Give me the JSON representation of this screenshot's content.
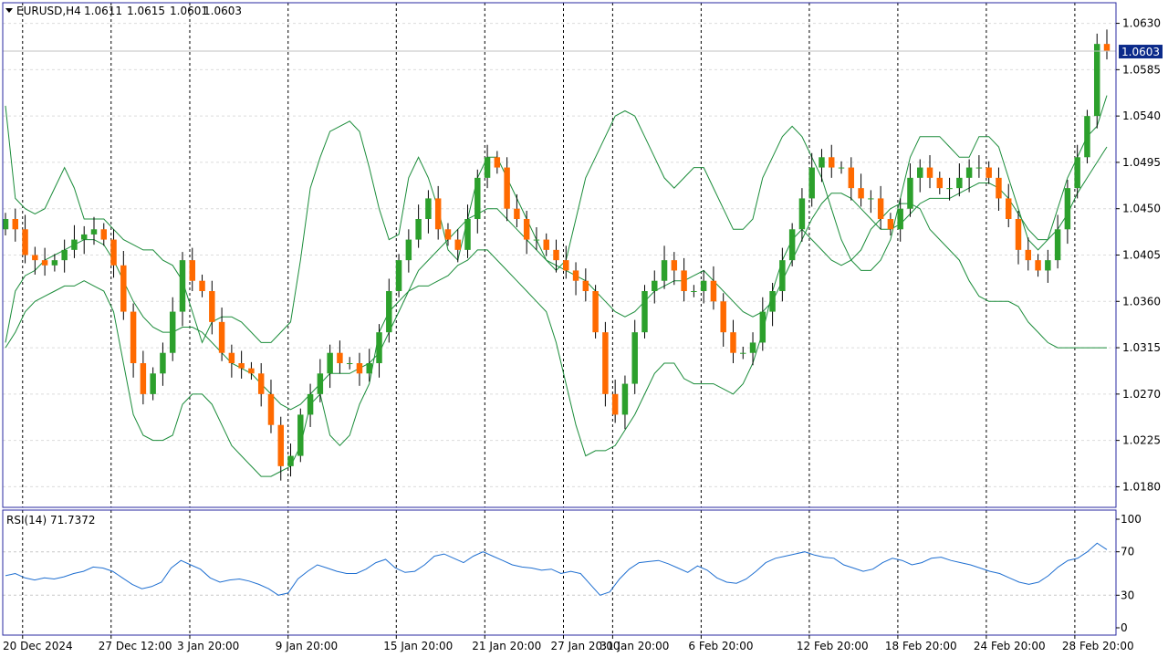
{
  "header": {
    "symbol": "EURUSD,H4",
    "open": "1.0611",
    "high": "1.0615",
    "low": "1.0601",
    "close": "1.0603"
  },
  "price_panel": {
    "current_price_label": "1.0603",
    "y_ticks": [
      "1.0630",
      "1.0585",
      "1.0540",
      "1.0495",
      "1.0450",
      "1.0405",
      "1.0360",
      "1.0315",
      "1.0270",
      "1.0225",
      "1.0180"
    ]
  },
  "rsi_panel": {
    "title": "RSI(14) 71.7372",
    "y_ticks": [
      "100",
      "70",
      "30",
      "0"
    ]
  },
  "x_axis_labels": [
    "20 Dec 2024",
    "27 Dec 12:00",
    "3 Jan 20:00",
    "9 Jan 20:00",
    "15 Jan 20:00",
    "21 Jan 20:00",
    "27 Jan 20:00",
    "31 Jan 20:00",
    "6 Feb 20:00",
    "12 Feb 20:00",
    "18 Feb 20:00",
    "24 Feb 20:00",
    "28 Feb 20:00"
  ],
  "colors": {
    "bull_candle": "#2ca02c",
    "bear_candle": "#ff6a00",
    "bollinger": "#1b8c3a",
    "rsi_line": "#1f6fd1",
    "frame": "#2a2aa0",
    "price_label_bg": "#0b2a8a"
  },
  "chart_data": [
    {
      "type": "candlestick",
      "indicator": "Bollinger Bands",
      "ylim": [
        1.016,
        1.065
      ],
      "series": [
        {
          "name": "close",
          "values": [
            1.044,
            1.043,
            1.0405,
            1.04,
            1.0395,
            1.04,
            1.041,
            1.042,
            1.0425,
            1.043,
            1.042,
            1.0395,
            1.035,
            1.03,
            1.027,
            1.029,
            1.031,
            1.035,
            1.04,
            1.038,
            1.037,
            1.034,
            1.031,
            1.03,
            1.0295,
            1.029,
            1.027,
            1.024,
            1.02,
            1.021,
            1.025,
            1.027,
            1.029,
            1.031,
            1.03,
            1.03,
            1.029,
            1.03,
            1.033,
            1.037,
            1.04,
            1.042,
            1.044,
            1.046,
            1.043,
            1.042,
            1.041,
            1.044,
            1.048,
            1.05,
            1.049,
            1.045,
            1.044,
            1.042,
            1.042,
            1.041,
            1.04,
            1.039,
            1.038,
            1.037,
            1.033,
            1.027,
            1.025,
            1.028,
            1.033,
            1.037,
            1.038,
            1.04,
            1.039,
            1.037,
            1.037,
            1.038,
            1.036,
            1.033,
            1.031,
            1.031,
            1.032,
            1.035,
            1.037,
            1.04,
            1.043,
            1.046,
            1.049,
            1.05,
            1.049,
            1.049,
            1.047,
            1.046,
            1.046,
            1.044,
            1.043,
            1.045,
            1.048,
            1.049,
            1.048,
            1.047,
            1.047,
            1.048,
            1.049,
            1.049,
            1.048,
            1.046,
            1.044,
            1.041,
            1.04,
            1.039,
            1.04,
            1.043,
            1.047,
            1.05,
            1.054,
            1.061,
            1.0603
          ]
        },
        {
          "name": "upper band",
          "values": [
            1.055,
            1.046,
            1.045,
            1.0445,
            1.045,
            1.047,
            1.049,
            1.047,
            1.044,
            1.044,
            1.044,
            1.043,
            1.042,
            1.0415,
            1.041,
            1.041,
            1.04,
            1.0395,
            1.038,
            1.035,
            1.032,
            1.034,
            1.0345,
            1.0345,
            1.034,
            1.033,
            1.032,
            1.032,
            1.033,
            1.034,
            1.04,
            1.047,
            1.05,
            1.0525,
            1.053,
            1.0535,
            1.0525,
            1.049,
            1.045,
            1.042,
            1.0425,
            1.048,
            1.05,
            1.048,
            1.045,
            1.041,
            1.04,
            1.044,
            1.048,
            1.05,
            1.05,
            1.048,
            1.046,
            1.044,
            1.042,
            1.04,
            1.039,
            1.04,
            1.044,
            1.048,
            1.05,
            1.052,
            1.054,
            1.0545,
            1.054,
            1.052,
            1.05,
            1.048,
            1.047,
            1.048,
            1.049,
            1.049,
            1.047,
            1.045,
            1.043,
            1.043,
            1.044,
            1.048,
            1.05,
            1.052,
            1.053,
            1.052,
            1.05,
            1.048,
            1.045,
            1.042,
            1.04,
            1.039,
            1.039,
            1.04,
            1.042,
            1.046,
            1.05,
            1.052,
            1.052,
            1.052,
            1.051,
            1.05,
            1.05,
            1.052,
            1.052,
            1.051,
            1.048,
            1.045,
            1.042,
            1.041,
            1.042,
            1.045,
            1.048,
            1.05,
            1.052,
            1.053,
            1.056
          ]
        },
        {
          "name": "middle band",
          "values": [
            1.032,
            1.037,
            1.0385,
            1.039,
            1.04,
            1.0405,
            1.041,
            1.0415,
            1.042,
            1.042,
            1.0415,
            1.04,
            1.038,
            1.036,
            1.0345,
            1.0335,
            1.033,
            1.033,
            1.0335,
            1.0335,
            1.033,
            1.032,
            1.031,
            1.03,
            1.0295,
            1.029,
            1.028,
            1.027,
            1.026,
            1.0255,
            1.026,
            1.027,
            1.028,
            1.029,
            1.029,
            1.029,
            1.0295,
            1.03,
            1.031,
            1.033,
            1.035,
            1.037,
            1.039,
            1.04,
            1.041,
            1.042,
            1.043,
            1.044,
            1.0445,
            1.045,
            1.045,
            1.044,
            1.043,
            1.042,
            1.041,
            1.04,
            1.0395,
            1.039,
            1.0385,
            1.038,
            1.037,
            1.036,
            1.035,
            1.0345,
            1.035,
            1.036,
            1.037,
            1.0375,
            1.038,
            1.038,
            1.0385,
            1.039,
            1.038,
            1.037,
            1.036,
            1.035,
            1.0345,
            1.035,
            1.036,
            1.038,
            1.04,
            1.042,
            1.044,
            1.0455,
            1.0465,
            1.0465,
            1.046,
            1.045,
            1.044,
            1.043,
            1.043,
            1.0435,
            1.0445,
            1.0455,
            1.046,
            1.046,
            1.046,
            1.0465,
            1.047,
            1.0475,
            1.0475,
            1.047,
            1.046,
            1.0445,
            1.043,
            1.042,
            1.042,
            1.043,
            1.0445,
            1.0465,
            1.048,
            1.0495,
            1.051
          ]
        },
        {
          "name": "lower band",
          "values": [
            1.0315,
            1.033,
            1.035,
            1.036,
            1.0365,
            1.037,
            1.0375,
            1.0375,
            1.038,
            1.0375,
            1.037,
            1.035,
            1.03,
            1.025,
            1.023,
            1.0225,
            1.0225,
            1.023,
            1.026,
            1.027,
            1.027,
            1.026,
            1.024,
            1.022,
            1.021,
            1.02,
            1.019,
            1.019,
            1.0195,
            1.02,
            1.022,
            1.026,
            1.027,
            1.023,
            1.022,
            1.023,
            1.026,
            1.028,
            1.033,
            1.035,
            1.036,
            1.037,
            1.0375,
            1.0375,
            1.038,
            1.0385,
            1.0395,
            1.04,
            1.041,
            1.041,
            1.04,
            1.039,
            1.038,
            1.037,
            1.036,
            1.035,
            1.032,
            1.028,
            1.024,
            1.021,
            1.0215,
            1.0215,
            1.022,
            1.0235,
            1.025,
            1.027,
            1.029,
            1.03,
            1.03,
            1.0285,
            1.028,
            1.028,
            1.028,
            1.0275,
            1.027,
            1.028,
            1.03,
            1.033,
            1.037,
            1.04,
            1.042,
            1.043,
            1.042,
            1.041,
            1.04,
            1.0395,
            1.04,
            1.041,
            1.043,
            1.044,
            1.045,
            1.0455,
            1.0455,
            1.045,
            1.043,
            1.042,
            1.041,
            1.04,
            1.038,
            1.0365,
            1.036,
            1.036,
            1.036,
            1.0355,
            1.034,
            1.033,
            1.032,
            1.0315,
            1.0315,
            1.0315,
            1.0315,
            1.0315,
            1.0315
          ]
        }
      ]
    },
    {
      "type": "line",
      "indicator": "RSI(14)",
      "ylim": [
        0,
        100
      ],
      "gridlines": [
        70,
        30
      ],
      "series": [
        {
          "name": "RSI(14)",
          "values": [
            48,
            50,
            46,
            44,
            46,
            45,
            47,
            50,
            52,
            56,
            55,
            52,
            46,
            40,
            36,
            38,
            42,
            55,
            62,
            58,
            54,
            46,
            42,
            44,
            45,
            43,
            40,
            36,
            30,
            32,
            45,
            52,
            58,
            55,
            52,
            50,
            50,
            54,
            60,
            63,
            55,
            51,
            52,
            58,
            66,
            68,
            64,
            60,
            66,
            70,
            66,
            62,
            58,
            56,
            55,
            53,
            54,
            50,
            52,
            50,
            40,
            30,
            33,
            45,
            54,
            60,
            61,
            62,
            59,
            55,
            51,
            57,
            53,
            46,
            42,
            41,
            45,
            52,
            60,
            64,
            66,
            68,
            70,
            67,
            65,
            64,
            58,
            55,
            52,
            54,
            60,
            64,
            62,
            58,
            60,
            64,
            65,
            62,
            60,
            58,
            55,
            52,
            50,
            46,
            42,
            40,
            42,
            48,
            56,
            62,
            64,
            70,
            78,
            72
          ]
        }
      ]
    }
  ]
}
